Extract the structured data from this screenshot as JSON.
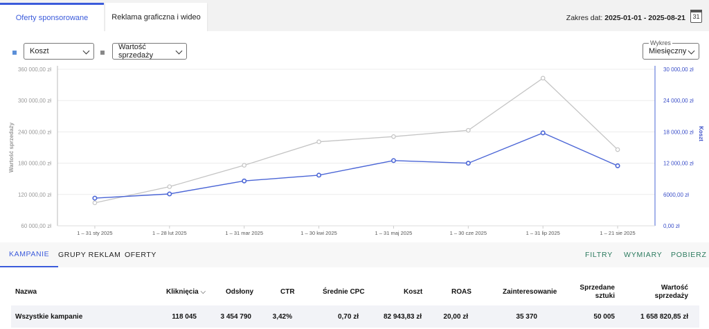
{
  "tabs": {
    "sponsored": "Oferty sponsorowane",
    "display": "Reklama graficzna i wideo"
  },
  "date_range": {
    "label": "Zakres dat:",
    "value": "2025-01-01 - 2025-08-21",
    "calendar_day": "31"
  },
  "controls": {
    "metric_left": "Koszt",
    "metric_right": "Wartość sprzedaży",
    "chart_label": "Wykres",
    "chart_period": "Miesięczny",
    "left_color": "#5b8fd8",
    "right_color": "#888888"
  },
  "chart_data": {
    "type": "line",
    "x": [
      "1 – 31 sty 2025",
      "1 – 28 lut 2025",
      "1 – 31 mar 2025",
      "1 – 30 kwi 2025",
      "1 – 31 maj 2025",
      "1 – 30 cze 2025",
      "1 – 31 lip 2025",
      "1 – 21 sie 2025"
    ],
    "series": [
      {
        "name": "Wartość sprzedaży",
        "axis": "left",
        "color": "#c4c4c4",
        "values": [
          104000,
          135000,
          176000,
          221000,
          231000,
          243000,
          343000,
          206000
        ]
      },
      {
        "name": "Koszt",
        "axis": "right",
        "color": "#4a65d6",
        "values": [
          5300,
          6100,
          8600,
          9700,
          12500,
          12000,
          17800,
          11500
        ]
      }
    ],
    "left_axis": {
      "label": "Wartość sprzedaży",
      "min": 60000,
      "max": 360000,
      "ticks": [
        "60 000,00 zł",
        "120 000,00 zł",
        "180 000,00 zł",
        "240 000,00 zł",
        "300 000,00 zł",
        "360 000,00 zł"
      ]
    },
    "right_axis": {
      "label": "Koszt",
      "min": 0,
      "max": 30000,
      "ticks": [
        "0,00 zł",
        "6000,00 zł",
        "12 000,00 zł",
        "18 000,00 zł",
        "24 000,00 zł",
        "30 000,00 zł"
      ]
    },
    "grid": true
  },
  "bottom_tabs": [
    "KAMPANIE",
    "GRUPY REKLAM",
    "OFERTY"
  ],
  "bottom_links": [
    "FILTRY",
    "WYMIARY",
    "POBIERZ"
  ],
  "table": {
    "headers": {
      "name": "Nazwa",
      "clicks": "Kliknięcia",
      "views": "Odsłony",
      "ctr": "CTR",
      "cpc": "Średnie CPC",
      "cost": "Koszt",
      "roas": "ROAS",
      "interest": "Zainteresowanie",
      "sold1": "Sprzedane",
      "sold2": "sztuki",
      "value1": "Wartość",
      "value2": "sprzedaży"
    },
    "row": {
      "name": "Wszystkie kampanie",
      "clicks": "118 045",
      "views": "3 454 790",
      "ctr": "3,42%",
      "cpc": "0,70 zł",
      "cost": "82 943,83 zł",
      "roas": "20,00 zł",
      "interest": "35 370",
      "sold": "50 005",
      "value": "1 658 820,85 zł"
    }
  }
}
